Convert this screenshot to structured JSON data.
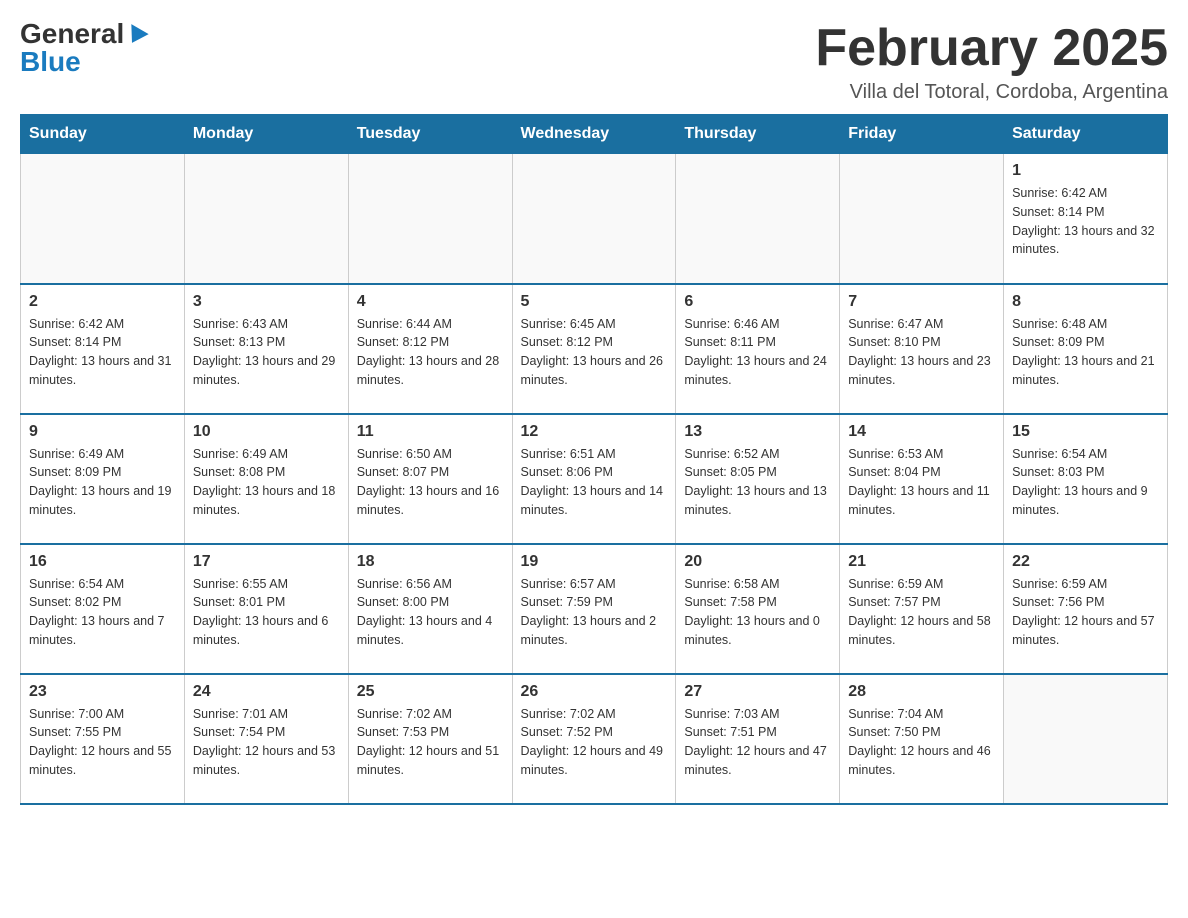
{
  "header": {
    "logo_general": "General",
    "logo_blue": "Blue",
    "title": "February 2025",
    "subtitle": "Villa del Totoral, Cordoba, Argentina"
  },
  "calendar": {
    "days_of_week": [
      "Sunday",
      "Monday",
      "Tuesday",
      "Wednesday",
      "Thursday",
      "Friday",
      "Saturday"
    ],
    "weeks": [
      [
        {
          "day": "",
          "info": ""
        },
        {
          "day": "",
          "info": ""
        },
        {
          "day": "",
          "info": ""
        },
        {
          "day": "",
          "info": ""
        },
        {
          "day": "",
          "info": ""
        },
        {
          "day": "",
          "info": ""
        },
        {
          "day": "1",
          "info": "Sunrise: 6:42 AM\nSunset: 8:14 PM\nDaylight: 13 hours and 32 minutes."
        }
      ],
      [
        {
          "day": "2",
          "info": "Sunrise: 6:42 AM\nSunset: 8:14 PM\nDaylight: 13 hours and 31 minutes."
        },
        {
          "day": "3",
          "info": "Sunrise: 6:43 AM\nSunset: 8:13 PM\nDaylight: 13 hours and 29 minutes."
        },
        {
          "day": "4",
          "info": "Sunrise: 6:44 AM\nSunset: 8:12 PM\nDaylight: 13 hours and 28 minutes."
        },
        {
          "day": "5",
          "info": "Sunrise: 6:45 AM\nSunset: 8:12 PM\nDaylight: 13 hours and 26 minutes."
        },
        {
          "day": "6",
          "info": "Sunrise: 6:46 AM\nSunset: 8:11 PM\nDaylight: 13 hours and 24 minutes."
        },
        {
          "day": "7",
          "info": "Sunrise: 6:47 AM\nSunset: 8:10 PM\nDaylight: 13 hours and 23 minutes."
        },
        {
          "day": "8",
          "info": "Sunrise: 6:48 AM\nSunset: 8:09 PM\nDaylight: 13 hours and 21 minutes."
        }
      ],
      [
        {
          "day": "9",
          "info": "Sunrise: 6:49 AM\nSunset: 8:09 PM\nDaylight: 13 hours and 19 minutes."
        },
        {
          "day": "10",
          "info": "Sunrise: 6:49 AM\nSunset: 8:08 PM\nDaylight: 13 hours and 18 minutes."
        },
        {
          "day": "11",
          "info": "Sunrise: 6:50 AM\nSunset: 8:07 PM\nDaylight: 13 hours and 16 minutes."
        },
        {
          "day": "12",
          "info": "Sunrise: 6:51 AM\nSunset: 8:06 PM\nDaylight: 13 hours and 14 minutes."
        },
        {
          "day": "13",
          "info": "Sunrise: 6:52 AM\nSunset: 8:05 PM\nDaylight: 13 hours and 13 minutes."
        },
        {
          "day": "14",
          "info": "Sunrise: 6:53 AM\nSunset: 8:04 PM\nDaylight: 13 hours and 11 minutes."
        },
        {
          "day": "15",
          "info": "Sunrise: 6:54 AM\nSunset: 8:03 PM\nDaylight: 13 hours and 9 minutes."
        }
      ],
      [
        {
          "day": "16",
          "info": "Sunrise: 6:54 AM\nSunset: 8:02 PM\nDaylight: 13 hours and 7 minutes."
        },
        {
          "day": "17",
          "info": "Sunrise: 6:55 AM\nSunset: 8:01 PM\nDaylight: 13 hours and 6 minutes."
        },
        {
          "day": "18",
          "info": "Sunrise: 6:56 AM\nSunset: 8:00 PM\nDaylight: 13 hours and 4 minutes."
        },
        {
          "day": "19",
          "info": "Sunrise: 6:57 AM\nSunset: 7:59 PM\nDaylight: 13 hours and 2 minutes."
        },
        {
          "day": "20",
          "info": "Sunrise: 6:58 AM\nSunset: 7:58 PM\nDaylight: 13 hours and 0 minutes."
        },
        {
          "day": "21",
          "info": "Sunrise: 6:59 AM\nSunset: 7:57 PM\nDaylight: 12 hours and 58 minutes."
        },
        {
          "day": "22",
          "info": "Sunrise: 6:59 AM\nSunset: 7:56 PM\nDaylight: 12 hours and 57 minutes."
        }
      ],
      [
        {
          "day": "23",
          "info": "Sunrise: 7:00 AM\nSunset: 7:55 PM\nDaylight: 12 hours and 55 minutes."
        },
        {
          "day": "24",
          "info": "Sunrise: 7:01 AM\nSunset: 7:54 PM\nDaylight: 12 hours and 53 minutes."
        },
        {
          "day": "25",
          "info": "Sunrise: 7:02 AM\nSunset: 7:53 PM\nDaylight: 12 hours and 51 minutes."
        },
        {
          "day": "26",
          "info": "Sunrise: 7:02 AM\nSunset: 7:52 PM\nDaylight: 12 hours and 49 minutes."
        },
        {
          "day": "27",
          "info": "Sunrise: 7:03 AM\nSunset: 7:51 PM\nDaylight: 12 hours and 47 minutes."
        },
        {
          "day": "28",
          "info": "Sunrise: 7:04 AM\nSunset: 7:50 PM\nDaylight: 12 hours and 46 minutes."
        },
        {
          "day": "",
          "info": ""
        }
      ]
    ]
  }
}
